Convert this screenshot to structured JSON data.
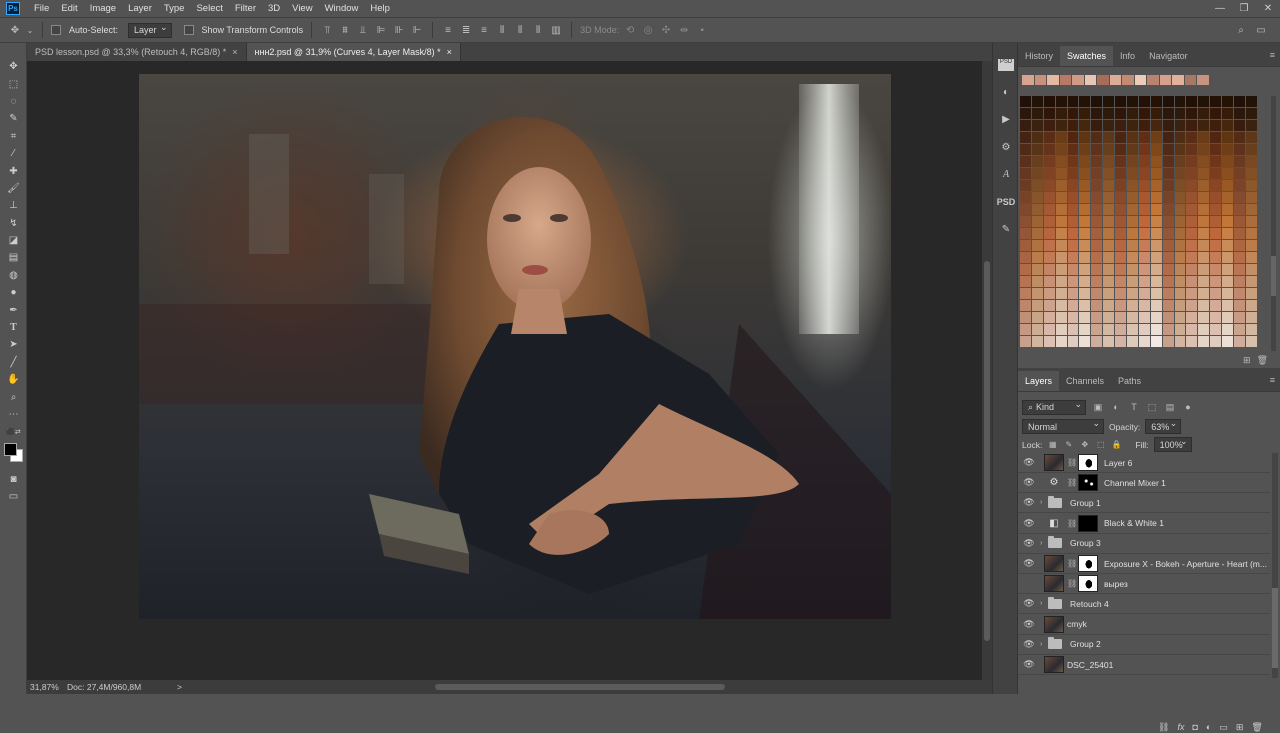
{
  "menubar": {
    "logo": "Ps",
    "items": [
      "File",
      "Edit",
      "Image",
      "Layer",
      "Type",
      "Select",
      "Filter",
      "3D",
      "View",
      "Window",
      "Help"
    ]
  },
  "options": {
    "auto_select_label": "Auto-Select:",
    "auto_select_value": "Layer",
    "transform_label": "Show Transform Controls",
    "mode_label": "3D Mode:"
  },
  "tabs": [
    {
      "title": "PSD lesson.psd @ 33,3% (Retouch 4, RGB/8) *",
      "close": "×"
    },
    {
      "title": "ннн2.psd @ 31,9% (Curves 4, Layer Mask/8) *",
      "close": "×"
    }
  ],
  "status": {
    "zoom": "31,87%",
    "doc": "Doc: 27,4M/960,8M",
    "arrow": ">"
  },
  "swatches": {
    "tabs": [
      "History",
      "Swatches",
      "Info",
      "Navigator"
    ],
    "active_tab": "Swatches",
    "recent": [
      "#d9a48f",
      "#c9917c",
      "#e3b9a6",
      "#b77a65",
      "#cf9b86",
      "#e8c6b5",
      "#a86d59",
      "#dcae99",
      "#c48a74",
      "#eccbbb",
      "#b98370",
      "#d6a18c",
      "#e0b29e",
      "#a97864",
      "#c79380"
    ]
  },
  "layers": {
    "tabs": [
      "Layers",
      "Channels",
      "Paths"
    ],
    "active_tab": "Layers",
    "kind_label": "Kind",
    "blend_mode": "Normal",
    "opacity_label": "Opacity:",
    "opacity_value": "63%",
    "lock_label": "Lock:",
    "fill_label": "Fill:",
    "fill_value": "100%",
    "items": [
      {
        "name": "Layer 6",
        "type": "pixel-mask",
        "visible": true,
        "mask": "white-figure"
      },
      {
        "name": "Channel Mixer 1",
        "type": "adjustment",
        "visible": true,
        "icon": "channel-mixer-icon",
        "mask": "black-dots"
      },
      {
        "name": "Group 1",
        "type": "group",
        "visible": true
      },
      {
        "name": "Black & White 1",
        "type": "adjustment",
        "visible": true,
        "icon": "black-white-icon",
        "mask": "black"
      },
      {
        "name": "Group 3",
        "type": "group",
        "visible": true
      },
      {
        "name": "Exposure X - Bokeh - Aperture - Heart (m...",
        "type": "pixel-mask",
        "visible": true,
        "mask": "white-figure"
      },
      {
        "name": "вырез",
        "type": "pixel-mask",
        "visible": false,
        "mask": "white-figure"
      },
      {
        "name": "Retouch 4",
        "type": "group",
        "visible": true
      },
      {
        "name": "cmyk",
        "type": "pixel",
        "visible": true
      },
      {
        "name": "Group 2",
        "type": "group",
        "visible": true
      },
      {
        "name": "DSC_25401",
        "type": "pixel",
        "visible": true
      }
    ]
  }
}
